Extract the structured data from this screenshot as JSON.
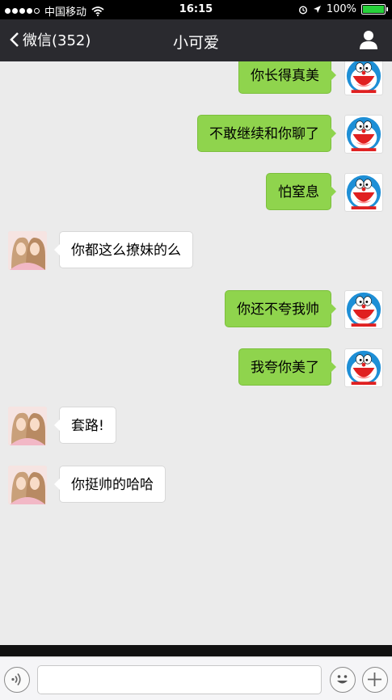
{
  "status_bar": {
    "carrier": "中国移动",
    "time": "16:15",
    "battery": "100%",
    "battery_level": 1.0,
    "signal_dots_filled": 4,
    "signal_dots_total": 5
  },
  "nav": {
    "back_label": "微信(352)",
    "title": "小可爱",
    "profile_icon": "person-icon"
  },
  "messages": [
    {
      "sender": "me",
      "text": "你长得真美"
    },
    {
      "sender": "me",
      "text": "不敢继续和你聊了"
    },
    {
      "sender": "me",
      "text": "怕窒息"
    },
    {
      "sender": "them",
      "text": "你都这么撩妹的么"
    },
    {
      "sender": "me",
      "text": "你还不夸我帅"
    },
    {
      "sender": "me",
      "text": "我夸你美了"
    },
    {
      "sender": "them",
      "text": "套路!"
    },
    {
      "sender": "them",
      "text": "你挺帅的哈哈"
    }
  ],
  "input_bar": {
    "voice_icon": "voice-icon",
    "emoji_icon": "emoji-icon",
    "plus_icon": "plus-icon",
    "placeholder": ""
  },
  "colors": {
    "my_bubble": "#8fd44d",
    "their_bubble": "#ffffff",
    "nav_bg": "#2a2a2f",
    "chat_bg": "#ebebeb"
  }
}
